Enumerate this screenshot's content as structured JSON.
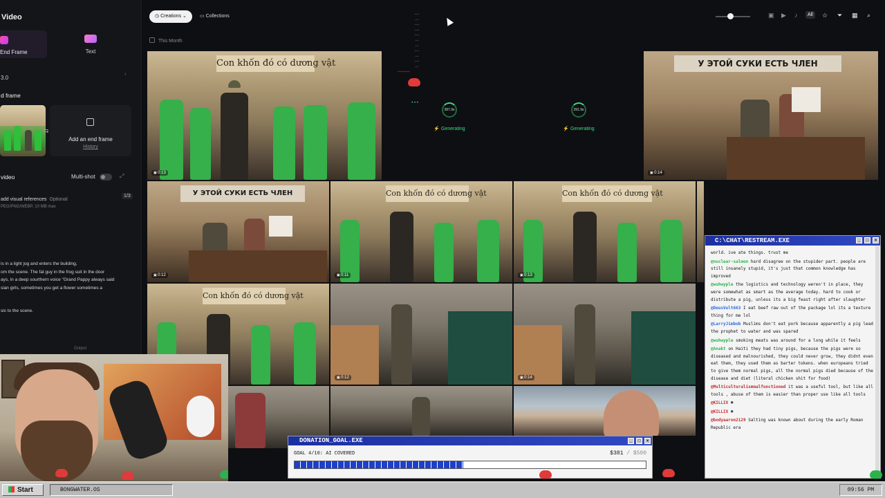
{
  "left_panel": {
    "title": "Video",
    "mode_start_end": "End Frame",
    "mode_text": "Text",
    "model_version": "3.0",
    "end_frame_heading": "d frame",
    "add_end_frame": "Add an end frame",
    "history": "History",
    "video_label": "video",
    "multishot_label": "Multi-shot",
    "refs_label": "add visual references",
    "refs_optional": "Optional",
    "refs_count": "1/3",
    "refs_formats": "PEG/PNG/WEBP, 10 MB max",
    "prompt_lines": [
      "is in a light jog and enters the building,",
      "om the scene. The fat guy in the frog suit in the door",
      "ays, in a deep sourthern voice \"Grand Pappy always said",
      "sian girls, sometimes you get a flower sometimes a"
    ],
    "prompt_tail": "sic to the scene.",
    "output_label": "Output"
  },
  "toolbar": {
    "creations": "Creations",
    "collections": "Collections",
    "all": "All",
    "filter_label": "This Month"
  },
  "grid": {
    "sign_vn": "Con khốn đó có dương vật",
    "sign_ru": "У ЭТОЙ СУКИ ЕСТЬ ЧЛЕН",
    "durations": [
      "0:13",
      "0:14",
      "0:12",
      "0:11",
      "0:13",
      "0:12",
      "0:14"
    ],
    "generating_label": "Generating",
    "progress_a": "387.9s",
    "progress_b": "391.9s"
  },
  "chat": {
    "title": "C:\\CHAT\\RESTREAM.EXE",
    "messages": [
      {
        "user": "",
        "text": "world. ive ate things. trust me"
      },
      {
        "user": "@nuclear-salmon",
        "text": "hard disagree on the stupider part. people are still insanely stupid, it's just that common knowledge has improved"
      },
      {
        "user": "@wuhwyple",
        "text": "the logistics and technology weren't in place, they were somewhat as smart as the average today. hard to cook or distribute a pig, unless its a big feast right after slaughter"
      },
      {
        "user": "@DeusVult663",
        "text": "I eat beef raw out of the package lol its a texture thing for me lol"
      },
      {
        "user": "@LarryJimbob",
        "text": "Muslims don't eat pork because apparently a pig lead the prophet to water and was spared"
      },
      {
        "user": "@wuhwyple",
        "text": "smoking meats was around for a long while it feels"
      },
      {
        "user": "@Anakt",
        "text": "on Haiti they had tiny pigs, because the pigs were so diseased and malnourished, they could never grow, they didnt even eat them, they used them as barter tokens. when europeans tried to give them normal pigs, all the normal pigs died because of the disease and diet (literal chicken shit for food)"
      },
      {
        "user": "@Multiculturalismmalfunctioned",
        "text": "it was a useful tool, but like all tools , abuse of them is easier than proper use like all tools"
      },
      {
        "user": "@KILLIX",
        "text": ""
      },
      {
        "user": "@KILLIX",
        "text": ""
      },
      {
        "user": "@bodyaaron2129",
        "text": "Salting was known about during the early Roman Republic era"
      }
    ]
  },
  "donation": {
    "title": "DONATION_GOAL.EXE",
    "goal_text": "GOAL 4/10: AI COVERED",
    "raised": "$381",
    "target": "/ $500",
    "progress": 0.48
  },
  "taskbar": {
    "start": "Start",
    "task": "BONGWATER.OS",
    "clock": "09:56 PM"
  },
  "colors": {
    "accent_green": "#3ddc84",
    "window_title_blue": "#1c2fa0",
    "pill_active": "#f1f1f3"
  }
}
